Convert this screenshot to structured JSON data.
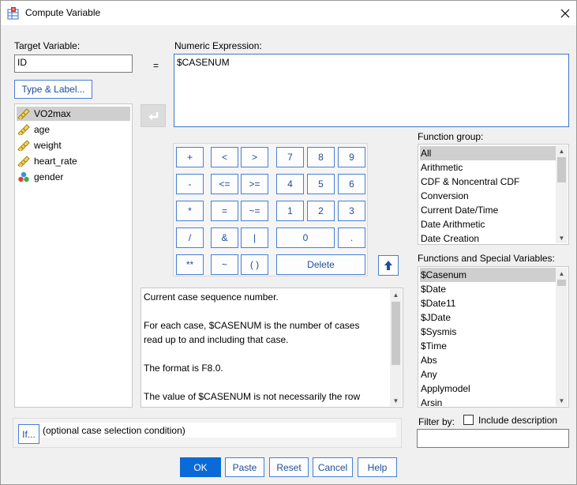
{
  "window": {
    "title": "Compute Variable"
  },
  "target": {
    "label": "Target Variable:",
    "value": "ID",
    "type_label_button": "Type & Label..."
  },
  "equals": "=",
  "expression": {
    "label": "Numeric Expression:",
    "value": "$CASENUM"
  },
  "variables": [
    {
      "name": "VO2max",
      "icon": "scale-ruler-icon",
      "selected": true
    },
    {
      "name": "age",
      "icon": "scale-ruler-icon"
    },
    {
      "name": "weight",
      "icon": "scale-ruler-icon"
    },
    {
      "name": "heart_rate",
      "icon": "scale-ruler-icon"
    },
    {
      "name": "gender",
      "icon": "nominal-circles-icon"
    }
  ],
  "keypad": {
    "row1": [
      "+",
      "<",
      ">",
      "7",
      "8",
      "9"
    ],
    "row2": [
      "-",
      "<=",
      ">=",
      "4",
      "5",
      "6"
    ],
    "row3": [
      "*",
      "=",
      "~=",
      "1",
      "2",
      "3"
    ],
    "row4": [
      "/",
      "&",
      "|",
      "0",
      "."
    ],
    "row5": [
      "**",
      "~",
      "( )",
      "Delete"
    ]
  },
  "description": [
    "Current case sequence number.",
    "",
    "For each case, $CASENUM is the number of cases",
    "read up to and including that case.",
    "",
    "The format is F8.0.",
    "",
    "The value of $CASENUM is not necessarily the row"
  ],
  "function_group": {
    "label": "Function group:",
    "items": [
      "All",
      "Arithmetic",
      "CDF & Noncentral CDF",
      "Conversion",
      "Current Date/Time",
      "Date Arithmetic",
      "Date Creation"
    ]
  },
  "functions": {
    "label": "Functions and Special Variables:",
    "items": [
      "$Casenum",
      "$Date",
      "$Date11",
      "$JDate",
      "$Sysmis",
      "$Time",
      "Abs",
      "Any",
      "Applymodel",
      "Arsin"
    ]
  },
  "filter": {
    "label": "Filter by:",
    "checkbox_label": "Include description",
    "value": ""
  },
  "if": {
    "button": "If...",
    "text": "(optional case selection condition)"
  },
  "buttons": {
    "ok": "OK",
    "paste": "Paste",
    "reset": "Reset",
    "cancel": "Cancel",
    "help": "Help"
  }
}
